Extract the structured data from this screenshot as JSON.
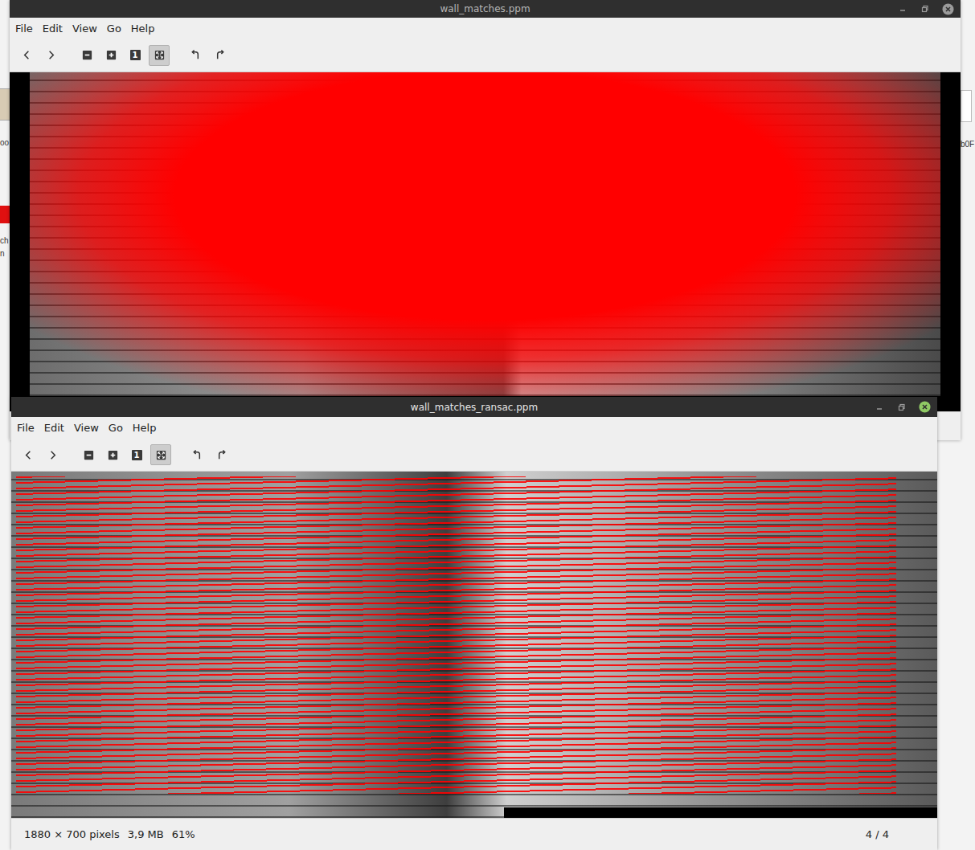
{
  "desktop": {
    "left_icons": [
      {
        "labels": [
          "oo"
        ]
      },
      {
        "labels": [
          "ch",
          "n"
        ]
      }
    ],
    "right_icons": [
      {
        "labels": [
          "b0F"
        ]
      }
    ]
  },
  "windows": [
    {
      "title": "wall_matches.ppm",
      "active": false,
      "menu": [
        "File",
        "Edit",
        "View",
        "Go",
        "Help"
      ],
      "toolbar": [
        [
          {
            "kind": "back",
            "selected": false
          },
          {
            "kind": "forward",
            "selected": false
          }
        ],
        [
          {
            "kind": "zoom-out",
            "selected": false
          },
          {
            "kind": "zoom-in",
            "selected": false
          },
          {
            "kind": "normal-size",
            "glyph": "1",
            "selected": false
          },
          {
            "kind": "fit",
            "selected": true
          }
        ],
        [
          {
            "kind": "rotate-left",
            "selected": false
          },
          {
            "kind": "rotate-right",
            "selected": false
          }
        ]
      ],
      "image": {
        "kind": "all-matches"
      },
      "status_bar": null
    },
    {
      "title": "wall_matches_ransac.ppm",
      "active": true,
      "menu": [
        "File",
        "Edit",
        "View",
        "Go",
        "Help"
      ],
      "toolbar": [
        [
          {
            "kind": "back",
            "selected": false
          },
          {
            "kind": "forward",
            "selected": false
          }
        ],
        [
          {
            "kind": "zoom-out",
            "selected": false
          },
          {
            "kind": "zoom-in",
            "selected": false
          },
          {
            "kind": "normal-size",
            "glyph": "1",
            "selected": false
          },
          {
            "kind": "fit",
            "selected": true
          }
        ],
        [
          {
            "kind": "rotate-left",
            "selected": false
          },
          {
            "kind": "rotate-right",
            "selected": false
          }
        ]
      ],
      "image": {
        "kind": "ransac-matches"
      },
      "status_bar": {
        "dimensions": "1880 × 700 pixels",
        "file_size": "3,9 MB",
        "zoom": "61%",
        "position": "4 / 4"
      }
    }
  ]
}
